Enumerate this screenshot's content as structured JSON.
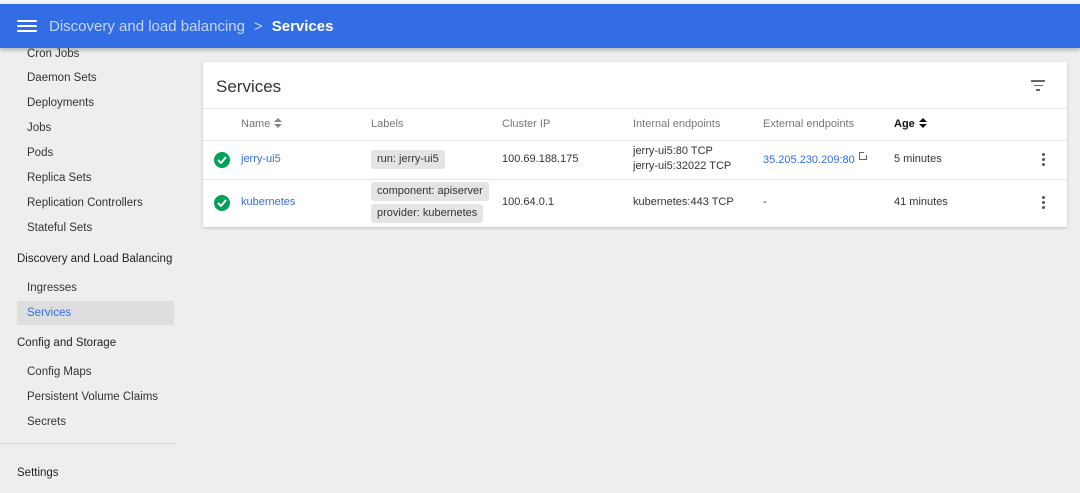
{
  "header": {
    "breadcrumb_parent": "Discovery and load balancing",
    "breadcrumb_separator": ">",
    "breadcrumb_current": "Services",
    "bar_color": "#326de6"
  },
  "sidebar": {
    "items_top": [
      {
        "label": "Cron Jobs"
      },
      {
        "label": "Daemon Sets"
      },
      {
        "label": "Deployments"
      },
      {
        "label": "Jobs"
      },
      {
        "label": "Pods"
      },
      {
        "label": "Replica Sets"
      },
      {
        "label": "Replication Controllers"
      },
      {
        "label": "Stateful Sets"
      }
    ],
    "section_discovery": "Discovery and Load Balancing",
    "items_discovery": [
      {
        "label": "Ingresses"
      },
      {
        "label": "Services",
        "active": true
      }
    ],
    "section_config": "Config and Storage",
    "items_config": [
      {
        "label": "Config Maps"
      },
      {
        "label": "Persistent Volume Claims"
      },
      {
        "label": "Secrets"
      }
    ],
    "settings": "Settings"
  },
  "card": {
    "title": "Services",
    "filter_icon": "filter-list-icon",
    "columns": {
      "name": "Name",
      "labels": "Labels",
      "cluster_ip": "Cluster IP",
      "internal": "Internal endpoints",
      "external": "External endpoints",
      "age": "Age"
    },
    "rows": [
      {
        "status": "check-circle-icon",
        "name": "jerry-ui5",
        "labels": [
          "run: jerry-ui5"
        ],
        "cluster_ip": "100.69.188.175",
        "internal": [
          "jerry-ui5:80 TCP",
          "jerry-ui5:32022 TCP"
        ],
        "external": "35.205.230.209:80",
        "age": "5 minutes"
      },
      {
        "status": "check-circle-icon",
        "name": "kubernetes",
        "labels": [
          "component: apiserver",
          "provider: kubernetes"
        ],
        "cluster_ip": "100.64.0.1",
        "internal": [
          "kubernetes:443 TCP"
        ],
        "external": "-",
        "age": "41 minutes"
      }
    ]
  }
}
